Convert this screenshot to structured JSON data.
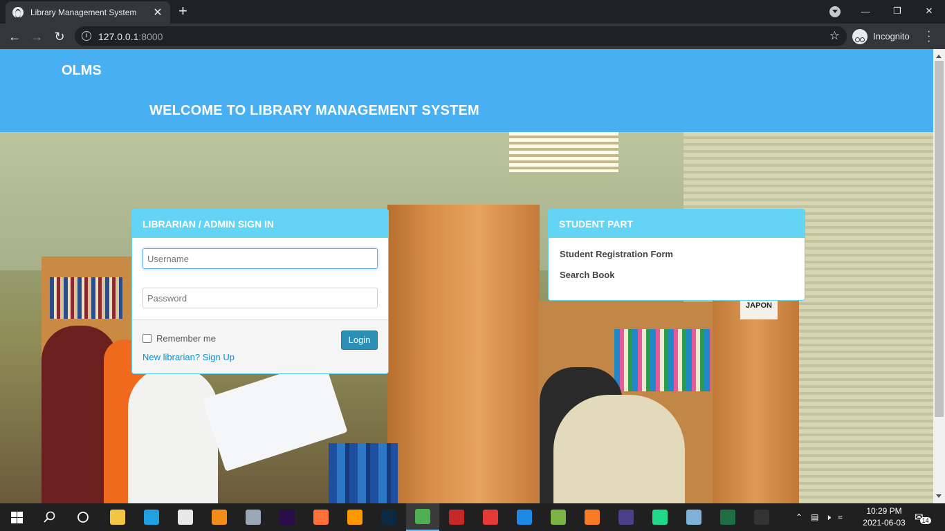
{
  "browser": {
    "tab_title": "Library Management System",
    "tab_close": "✕",
    "new_tab": "+",
    "url_host": "127.0.0.1",
    "url_port": ":8000",
    "incognito_label": "Incognito",
    "window_controls": [
      "—",
      "❐",
      "✕"
    ]
  },
  "header": {
    "brand": "OLMS",
    "welcome": "WELCOME TO LIBRARY MANAGEMENT SYSTEM"
  },
  "scene": {
    "sign_text": "JAPON"
  },
  "login": {
    "title": "LIBRARIAN / ADMIN SIGN IN",
    "username_placeholder": "Username",
    "password_placeholder": "Password",
    "remember_label": "Remember me",
    "login_button": "Login",
    "signup_link": "New librarian? Sign Up"
  },
  "student": {
    "title": "STUDENT PART",
    "links": [
      "Student Registration Form",
      "Search Book"
    ]
  },
  "taskbar": {
    "time": "10:29 PM",
    "date": "2021-06-03",
    "notification_count": "14",
    "apps": [
      {
        "icon": "file-explorer-icon",
        "color": "#f4c542"
      },
      {
        "icon": "edge-icon",
        "color": "#1fa0e0"
      },
      {
        "icon": "store-icon",
        "color": "#e8e8e8"
      },
      {
        "icon": "vlc-icon",
        "color": "#f28c1b"
      },
      {
        "icon": "camera-icon",
        "color": "#9aa7b8"
      },
      {
        "icon": "premiere-icon",
        "color": "#2a0d4a"
      },
      {
        "icon": "firefox-icon",
        "color": "#ff7139"
      },
      {
        "icon": "sublime-icon",
        "color": "#ff9800"
      },
      {
        "icon": "photoshop-icon",
        "color": "#0a2a44"
      },
      {
        "icon": "chrome-icon",
        "color": "#4caf50"
      },
      {
        "icon": "winrar-icon",
        "color": "#c62828"
      },
      {
        "icon": "app-red-icon",
        "color": "#e53935"
      },
      {
        "icon": "vscode-icon",
        "color": "#1e88e5"
      },
      {
        "icon": "android-studio-icon",
        "color": "#7cb342"
      },
      {
        "icon": "xampp-icon",
        "color": "#fb7a24"
      },
      {
        "icon": "eclipse-icon",
        "color": "#4b3f8c"
      },
      {
        "icon": "pycharm-icon",
        "color": "#21d789"
      },
      {
        "icon": "notepad-icon",
        "color": "#7fb2d8"
      },
      {
        "icon": "excel-icon",
        "color": "#1d6f42"
      },
      {
        "icon": "terminal-icon",
        "color": "#333333"
      }
    ]
  },
  "colors": {
    "header": "#48aff2",
    "panel_heading": "#64d4f5",
    "login_button": "#2b8fb6",
    "link": "#0e8fd0"
  }
}
